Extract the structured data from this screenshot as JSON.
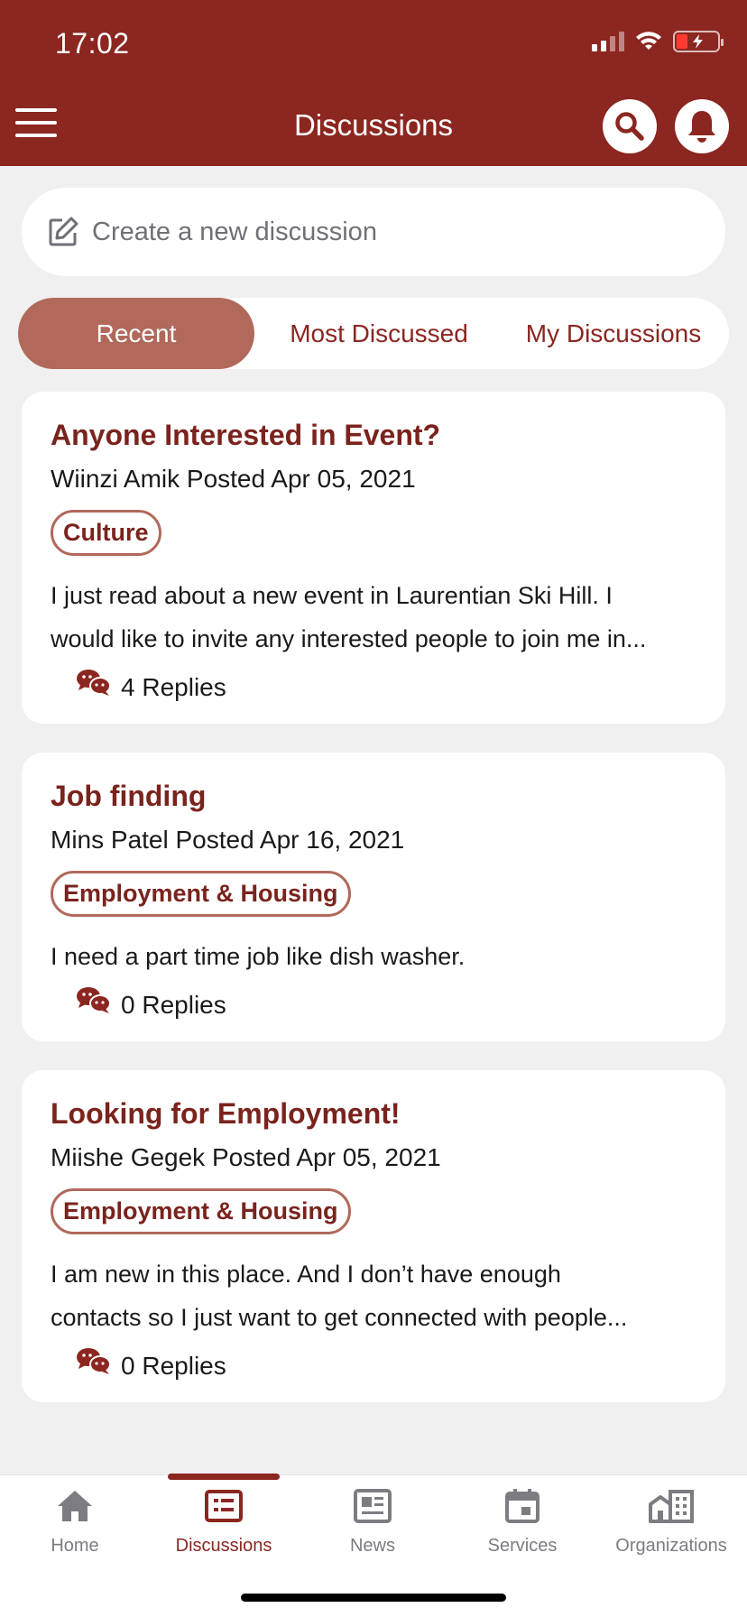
{
  "status_bar": {
    "time": "17:02"
  },
  "header": {
    "title": "Discussions"
  },
  "new_discussion": {
    "placeholder": "Create a new discussion"
  },
  "tabs": [
    {
      "label": "Recent",
      "active": true
    },
    {
      "label": "Most Discussed",
      "active": false
    },
    {
      "label": "My Discussions",
      "active": false
    }
  ],
  "discussions": [
    {
      "title": "Anyone Interested in Event?",
      "meta": "Wiinzi Amik Posted Apr 05, 2021",
      "tag": "Culture",
      "body_line1": "I just read about a new event in Laurentian Ski Hill. I",
      "body_line2": "would like to invite any interested people to join me in...",
      "replies": "4 Replies"
    },
    {
      "title": "Job finding",
      "meta": "Mins Patel Posted Apr 16, 2021",
      "tag": "Employment & Housing",
      "body_line1": "I need a part time job like dish washer.",
      "body_line2": "",
      "replies": "0 Replies"
    },
    {
      "title": "Looking for Employment!",
      "meta": "Miishe Gegek Posted Apr 05, 2021",
      "tag": "Employment & Housing",
      "body_line1": "I am new in this place. And I don’t have enough",
      "body_line2": "contacts so I just want to get connected with people...",
      "replies": "0 Replies"
    }
  ],
  "bottom_nav": [
    {
      "label": "Home",
      "icon": "home-icon",
      "active": false
    },
    {
      "label": "Discussions",
      "icon": "discussions-icon",
      "active": true
    },
    {
      "label": "News",
      "icon": "news-icon",
      "active": false
    },
    {
      "label": "Services",
      "icon": "calendar-icon",
      "active": false
    },
    {
      "label": "Organizations",
      "icon": "building-icon",
      "active": false
    }
  ],
  "colors": {
    "brand": "#8b2620",
    "accent": "#b0695b",
    "title_text": "#7a231d",
    "background": "#f1f0f0",
    "nav_inactive": "#7c7c82"
  }
}
